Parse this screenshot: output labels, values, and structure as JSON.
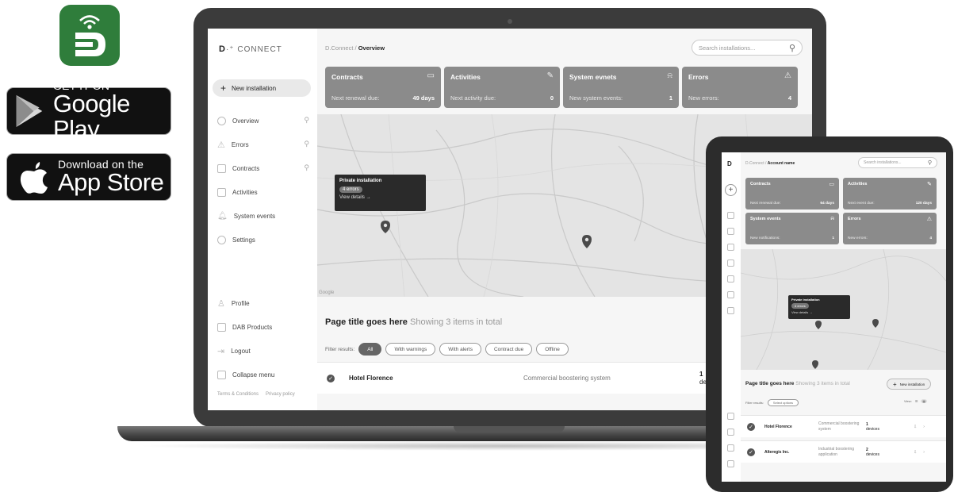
{
  "brand": {
    "logo_text": "CONNECT",
    "app_icon_color": "#2f7d3b"
  },
  "store_badges": {
    "google": {
      "small": "GET IT ON",
      "big": "Google Play"
    },
    "apple": {
      "small": "Download on the",
      "big": "App Store"
    }
  },
  "laptop": {
    "new_installation": "New installation",
    "nav": [
      "Overview",
      "Errors",
      "Contracts",
      "Activities",
      "System events",
      "Settings"
    ],
    "nav_bottom": [
      "Profile",
      "DAB Products",
      "Logout",
      "Collapse menu"
    ],
    "footer": {
      "terms": "Terms & Conditions",
      "privacy": "Privacy policy"
    },
    "breadcrumb": {
      "root": "D.Connect /",
      "current": "Overview"
    },
    "search_placeholder": "Search installations...",
    "cards": [
      {
        "title": "Contracts",
        "label": "Next renewal due:",
        "value": "49 days"
      },
      {
        "title": "Activities",
        "label": "Next activity due:",
        "value": "0"
      },
      {
        "title": "System evnets",
        "label": "New system events:",
        "value": "1"
      },
      {
        "title": "Errors",
        "label": "New errors:",
        "value": "4"
      }
    ],
    "map_popup": {
      "title": "Private installation",
      "badge": "4 errors",
      "link": "View details →"
    },
    "map_watermark": "Google",
    "page_title": "Page title goes here",
    "page_subtitle": "Showing 3 items in total",
    "filter_label": "Filter results:",
    "filters": [
      "All",
      "With warnings",
      "With alerts",
      "Contract due",
      "Offline"
    ],
    "row": {
      "name": "Hotel Florence",
      "type": "Commercial boostering system",
      "devices": "1",
      "devices_label": "de"
    }
  },
  "tablet": {
    "breadcrumb": {
      "root": "D.Connect /",
      "current": "Account name"
    },
    "search_placeholder": "Search installations...",
    "cards": [
      {
        "title": "Contracts",
        "label": "Next renewal due:",
        "value": "64 days"
      },
      {
        "title": "Activities",
        "label": "Next event due:",
        "value": "120 days"
      },
      {
        "title": "System events",
        "label": "New notifications:",
        "value": "1"
      },
      {
        "title": "Errors",
        "label": "New errors:",
        "value": "4"
      }
    ],
    "map_popup": {
      "title": "Private installation",
      "badge": "4 errors",
      "link": "View details →"
    },
    "page_title": "Page title goes here",
    "page_subtitle": "Showing 3 items in total",
    "new_installation": "New installation",
    "filter_label": "Filter results:",
    "filter_select": "Select options",
    "view_label": "View:",
    "rows": [
      {
        "name": "Hotel Florence",
        "type": "Commercial boostering system",
        "devices": "1",
        "devices_label": "devices"
      },
      {
        "name": "Alteregis Inc.",
        "type": "Industrial boostering application",
        "devices": "2",
        "devices_label": "devices"
      }
    ]
  }
}
